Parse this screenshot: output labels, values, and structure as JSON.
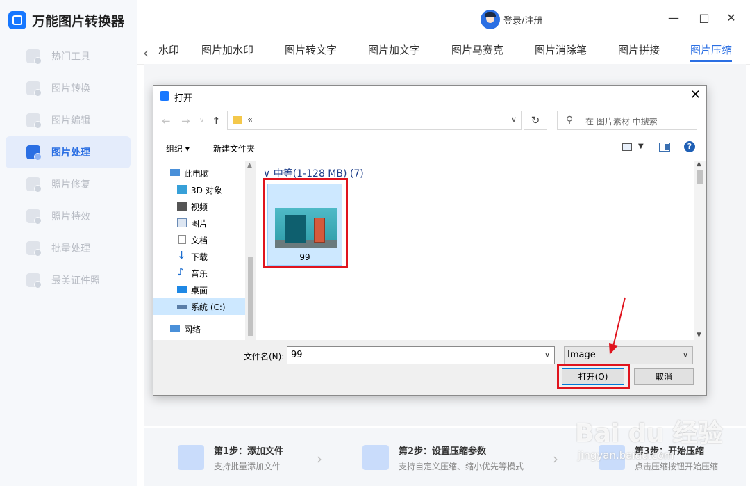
{
  "app": {
    "title": "万能图片转换器",
    "login": "登录/注册",
    "window_controls": {
      "minimize": "—",
      "maximize": "□",
      "close": "✕"
    }
  },
  "sidebar": {
    "items": [
      {
        "label": "热门工具",
        "active": false
      },
      {
        "label": "图片转换",
        "active": false
      },
      {
        "label": "图片编辑",
        "active": false
      },
      {
        "label": "图片处理",
        "active": true
      },
      {
        "label": "照片修复",
        "active": false
      },
      {
        "label": "照片特效",
        "active": false
      },
      {
        "label": "批量处理",
        "active": false
      },
      {
        "label": "最美证件照",
        "active": false
      }
    ]
  },
  "tabs": {
    "items": [
      "水印",
      "图片加水印",
      "图片转文字",
      "图片加文字",
      "图片马赛克",
      "图片消除笔",
      "图片拼接",
      "图片压缩"
    ],
    "active": "图片压缩"
  },
  "steps": [
    {
      "title": "第1步：添加文件",
      "desc": "支持批量添加文件"
    },
    {
      "title": "第2步：设置压缩参数",
      "desc": "支持自定义压缩、缩小优先等模式"
    },
    {
      "title": "第3步：开始压缩",
      "desc": "点击压缩按钮开始压缩"
    }
  ],
  "dialog": {
    "title": "打开",
    "address": "«",
    "search_placeholder": "在 图片素材 中搜索",
    "toolbar": {
      "organize": "组织 ▾",
      "new_folder": "新建文件夹",
      "help": "?"
    },
    "tree": [
      {
        "label": "此电脑",
        "icon": "computer-icon",
        "color": "#4a90d9"
      },
      {
        "label": "3D 对象",
        "icon": "cube-icon",
        "color": "#37a0d8"
      },
      {
        "label": "视频",
        "icon": "film-icon",
        "color": "#555555"
      },
      {
        "label": "图片",
        "icon": "picture-icon",
        "color": "#6a8bb5"
      },
      {
        "label": "文档",
        "icon": "document-icon",
        "color": "#8c8c8c"
      },
      {
        "label": "下载",
        "icon": "download-icon",
        "color": "#1e6fd0"
      },
      {
        "label": "音乐",
        "icon": "music-icon",
        "color": "#1e6fd0"
      },
      {
        "label": "桌面",
        "icon": "desktop-icon",
        "color": "#1e88e5"
      },
      {
        "label": "系统 (C:)",
        "icon": "drive-icon",
        "color": "#5a7ea8",
        "selected": true
      },
      {
        "label": "网络",
        "icon": "network-icon",
        "color": "#4a90d9"
      }
    ],
    "group_header": "中等(1-128 MB)  (7)",
    "file": {
      "name": "99"
    },
    "filename_label": "文件名(N):",
    "filename_value": "99",
    "file_type": "Image",
    "open_button": "打开(O)",
    "cancel_button": "取消"
  },
  "watermark": {
    "main": "Bai du 经验",
    "sub": "jingyan.baidu.com"
  },
  "colors": {
    "accent": "#2b6fe3",
    "highlight": "#e0141e",
    "selection": "#cde8ff"
  }
}
